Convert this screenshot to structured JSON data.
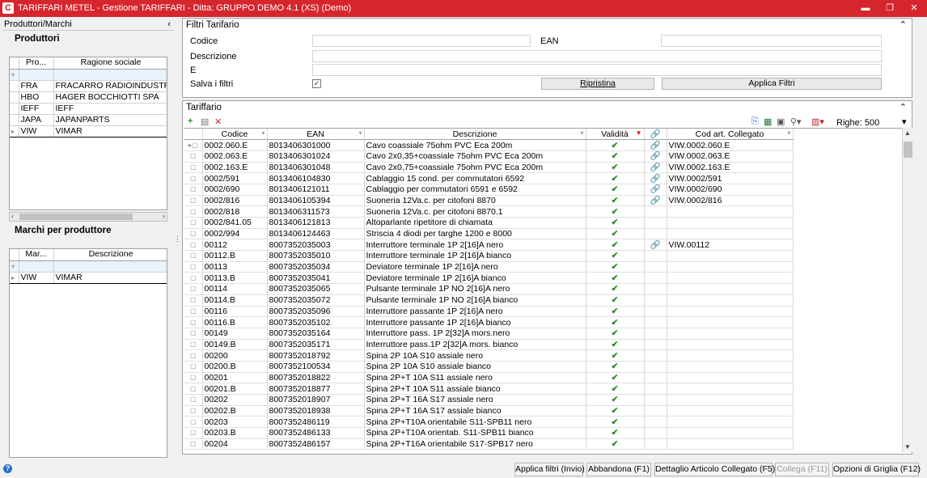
{
  "window": {
    "title": "TARIFFARI METEL - Gestione TARIFFARI - Ditta: GRUPPO DEMO 4.1 (XS)  (Demo)",
    "app_icon": "C",
    "minimize": "▬",
    "restore": "❐",
    "close": "✕"
  },
  "left": {
    "header": "Produttori/Marchi",
    "collapse": "‹",
    "producers_title": "Produttori",
    "producers_columns": [
      "Pro...",
      "Ragione sociale"
    ],
    "producers": [
      {
        "code": "FRA",
        "name": "FRACARRO RADIOINDUSTRI"
      },
      {
        "code": "HBO",
        "name": "HAGER BOCCHIOTTI SPA"
      },
      {
        "code": "IEFF",
        "name": "IEFF"
      },
      {
        "code": "JAPA",
        "name": "JAPANPARTS"
      },
      {
        "code": "VIW",
        "name": "VIMAR"
      }
    ],
    "brands_title": "Marchi per produttore",
    "brands_columns": [
      "Mar...",
      "Descrizione"
    ],
    "brands": [
      {
        "code": "VIW",
        "name": "VIMAR"
      }
    ]
  },
  "filters": {
    "title": "Filtri Tarifario",
    "codice_label": "Codice",
    "ean_label": "EAN",
    "descrizione_label": "Descrizione",
    "e_label": "E",
    "salva_label": "Salva i filtri",
    "salva_checked": "✓",
    "ripristina_label": "Ripristina",
    "applica_label": "Applica Filtri",
    "codice_value": "",
    "ean_value": "",
    "descrizione_value": "",
    "e_value": ""
  },
  "tariffario": {
    "title": "Tariffario",
    "righe_label": "Righe: 500",
    "columns": [
      "Codice",
      "EAN",
      "Descrizione",
      "Validità",
      "",
      "Cod art. Collegato"
    ],
    "rows": [
      {
        "codice": "0002.060.E",
        "ean": "8013406301000",
        "descrizione": "Cavo coassiale 75ohm PVC Eca 200m",
        "valid": "✔",
        "link": "🔗",
        "collegato": "VIW.0002.060.E"
      },
      {
        "codice": "0002.063.E",
        "ean": "8013406301024",
        "descrizione": "Cavo 2x0,35+coassiale 75ohm PVC Eca 200m",
        "valid": "✔",
        "link": "🔗",
        "collegato": "VIW.0002.063.E"
      },
      {
        "codice": "0002.163.E",
        "ean": "8013406301048",
        "descrizione": "Cavo 2x0,75+coassiale 75ohm PVC Eca 200m",
        "valid": "✔",
        "link": "🔗",
        "collegato": "VIW.0002.163.E"
      },
      {
        "codice": "0002/591",
        "ean": "8013406104830",
        "descrizione": "Cablaggio 15 cond. per commutatori 6592",
        "valid": "✔",
        "link": "🔗",
        "collegato": "VIW.0002/591"
      },
      {
        "codice": "0002/690",
        "ean": "8013406121011",
        "descrizione": "Cablaggio per commutatori 6591 e 6592",
        "valid": "✔",
        "link": "🔗",
        "collegato": "VIW.0002/690"
      },
      {
        "codice": "0002/816",
        "ean": "8013406105394",
        "descrizione": "Suoneria 12Va.c. per citofoni 8870",
        "valid": "✔",
        "link": "🔗",
        "collegato": "VIW.0002/816"
      },
      {
        "codice": "0002/818",
        "ean": "8013406311573",
        "descrizione": "Suoneria 12Va.c. per citofoni 8870.1",
        "valid": "✔",
        "link": "",
        "collegato": ""
      },
      {
        "codice": "0002/841.05",
        "ean": "8013406121813",
        "descrizione": "Altoparlante ripetitore di chiamata",
        "valid": "✔",
        "link": "",
        "collegato": ""
      },
      {
        "codice": "0002/994",
        "ean": "8013406124463",
        "descrizione": "Striscia 4 diodi per targhe 1200 e 8000",
        "valid": "✔",
        "link": "",
        "collegato": ""
      },
      {
        "codice": "00112",
        "ean": "8007352035003",
        "descrizione": "Interruttore terminale 1P 2[16]A nero",
        "valid": "✔",
        "link": "🔗",
        "collegato": "VIW.00112"
      },
      {
        "codice": "00112.B",
        "ean": "8007352035010",
        "descrizione": "Interruttore terminale 1P 2[16]A bianco",
        "valid": "✔",
        "link": "",
        "collegato": ""
      },
      {
        "codice": "00113",
        "ean": "8007352035034",
        "descrizione": "Deviatore terminale 1P 2[16]A nero",
        "valid": "✔",
        "link": "",
        "collegato": ""
      },
      {
        "codice": "00113.B",
        "ean": "8007352035041",
        "descrizione": "Deviatore terminale 1P 2[16]A bianco",
        "valid": "✔",
        "link": "",
        "collegato": ""
      },
      {
        "codice": "00114",
        "ean": "8007352035065",
        "descrizione": "Pulsante terminale 1P NO 2[16]A nero",
        "valid": "✔",
        "link": "",
        "collegato": ""
      },
      {
        "codice": "00114.B",
        "ean": "8007352035072",
        "descrizione": "Pulsante terminale 1P NO 2[16]A bianco",
        "valid": "✔",
        "link": "",
        "collegato": ""
      },
      {
        "codice": "00116",
        "ean": "8007352035096",
        "descrizione": "Interruttore passante 1P 2[16]A nero",
        "valid": "✔",
        "link": "",
        "collegato": ""
      },
      {
        "codice": "00116.B",
        "ean": "8007352035102",
        "descrizione": "Interruttore passante 1P 2[16]A bianco",
        "valid": "✔",
        "link": "",
        "collegato": ""
      },
      {
        "codice": "00149",
        "ean": "8007352035164",
        "descrizione": "Interruttore pass. 1P 2[32]A mors.nero",
        "valid": "✔",
        "link": "",
        "collegato": ""
      },
      {
        "codice": "00149.B",
        "ean": "8007352035171",
        "descrizione": "Interruttore pass.1P 2[32]A mors. bianco",
        "valid": "✔",
        "link": "",
        "collegato": ""
      },
      {
        "codice": "00200",
        "ean": "8007352018792",
        "descrizione": "Spina 2P 10A S10 assiale nero",
        "valid": "✔",
        "link": "",
        "collegato": ""
      },
      {
        "codice": "00200.B",
        "ean": "8007352100534",
        "descrizione": "Spina 2P 10A S10 assiale bianco",
        "valid": "✔",
        "link": "",
        "collegato": ""
      },
      {
        "codice": "00201",
        "ean": "8007352018822",
        "descrizione": "Spina 2P+T 10A S11 assiale nero",
        "valid": "✔",
        "link": "",
        "collegato": ""
      },
      {
        "codice": "00201.B",
        "ean": "8007352018877",
        "descrizione": "Spina 2P+T 10A S11 assiale bianco",
        "valid": "✔",
        "link": "",
        "collegato": ""
      },
      {
        "codice": "00202",
        "ean": "8007352018907",
        "descrizione": "Spina 2P+T 16A S17 assiale nero",
        "valid": "✔",
        "link": "",
        "collegato": ""
      },
      {
        "codice": "00202.B",
        "ean": "8007352018938",
        "descrizione": "Spina 2P+T 16A S17 assiale bianco",
        "valid": "✔",
        "link": "",
        "collegato": ""
      },
      {
        "codice": "00203",
        "ean": "8007352486119",
        "descrizione": "Spina 2P+T10A orientabile S11-SPB11 nero",
        "valid": "✔",
        "link": "",
        "collegato": ""
      },
      {
        "codice": "00203.B",
        "ean": "8007352486133",
        "descrizione": "Spina 2P+T10A orientab. S11-SPB11 bianco",
        "valid": "✔",
        "link": "",
        "collegato": ""
      },
      {
        "codice": "00204",
        "ean": "8007352486157",
        "descrizione": "Spina 2P+T16A orientabile S17-SPB17 nero",
        "valid": "✔",
        "link": "",
        "collegato": ""
      }
    ]
  },
  "bottom": {
    "help": "?",
    "buttons": [
      "Applica filtri (Invio)",
      "Abbandona (F1)",
      "Dettaglio Articolo Collegato (F5)",
      "Collega (F11)",
      "Opzioni di Griglia (F12)"
    ]
  },
  "colors": {
    "titlebar": "#d6262d",
    "check": "#2a8a2a",
    "filter_row": "#eaf2fb"
  }
}
